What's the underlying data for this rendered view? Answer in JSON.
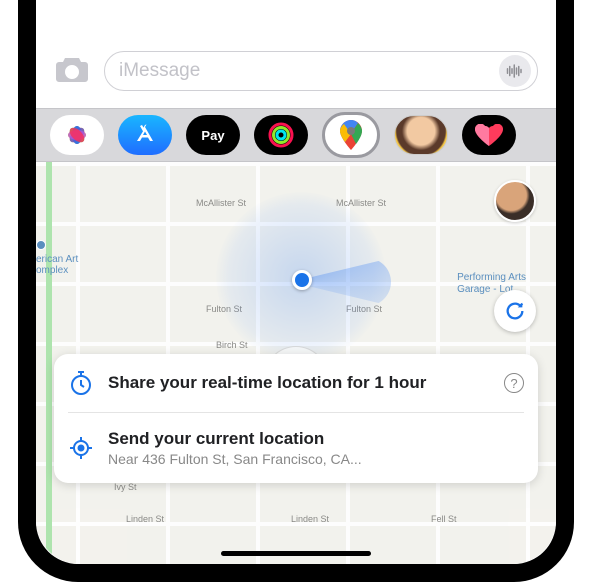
{
  "compose": {
    "placeholder": "iMessage"
  },
  "appDrawer": {
    "apps": [
      {
        "id": "photos",
        "label": "Photos"
      },
      {
        "id": "appstore",
        "label": "App Store"
      },
      {
        "id": "applepay",
        "label": "Pay"
      },
      {
        "id": "fitness",
        "label": "Fitness"
      },
      {
        "id": "googlemaps",
        "label": "Google Maps"
      },
      {
        "id": "memoji",
        "label": "Memoji"
      },
      {
        "id": "health",
        "label": "Health"
      }
    ]
  },
  "map": {
    "streets": {
      "mcallister": "McAllister St",
      "fulton": "Fulton St",
      "birch": "Birch St",
      "ivy": "Ivy St",
      "linden": "Linden St",
      "linden2": "Linden St",
      "fell": "Fell St"
    },
    "poi": {
      "artComplex1": "erican Art",
      "artComplex2": "omplex",
      "garage1": "Performing Arts",
      "garage2": "Garage - Lot..."
    }
  },
  "card": {
    "shareRealtime": {
      "title": "Share your real-time location for 1 hour"
    },
    "sendCurrent": {
      "title": "Send your current location",
      "subtitle": "Near 436 Fulton St, San Francisco, CA..."
    }
  }
}
